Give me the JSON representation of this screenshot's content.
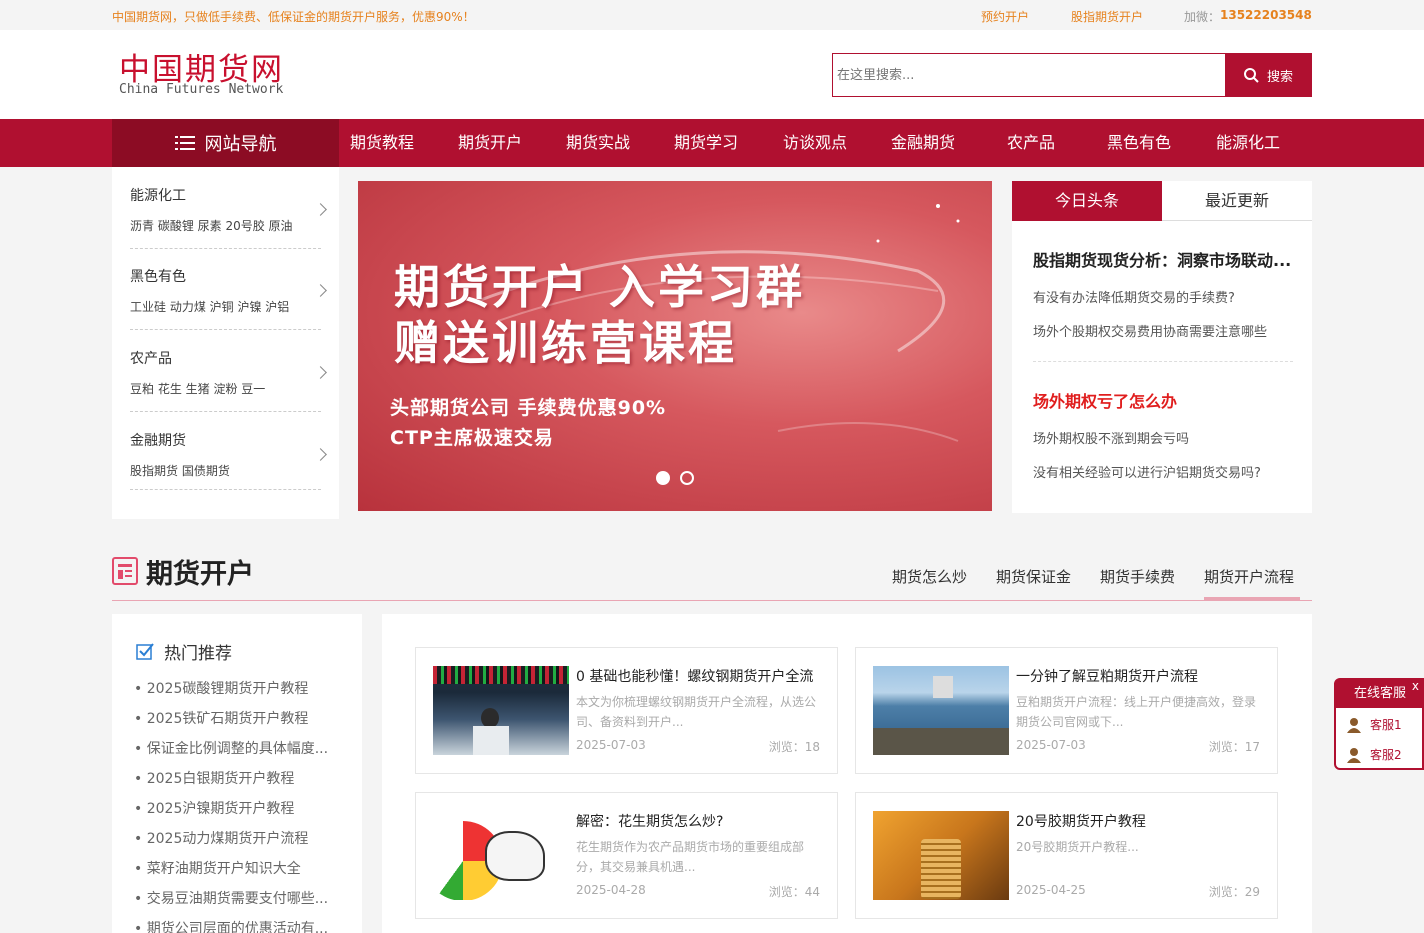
{
  "topbar": {
    "slogan": "中国期货网，只做低手续费、低保证金的期货开户服务，优惠90%！",
    "link1": "预约开户",
    "link2": "股指期货开户",
    "wechat_label": "加微：",
    "wechat": "13522203548"
  },
  "logo": {
    "cn": "中国期货网",
    "en": "China Futures Network"
  },
  "search": {
    "placeholder": "在这里搜索...",
    "button": "搜索"
  },
  "nav": {
    "home": "网站导航",
    "items": [
      "期货教程",
      "期货开户",
      "期货实战",
      "期货学习",
      "访谈观点",
      "金融期货",
      "农产品",
      "黑色有色",
      "能源化工"
    ]
  },
  "categories": [
    {
      "title": "能源化工",
      "subs": "沥青 碳酸锂 尿素 20号胶 原油"
    },
    {
      "title": "黑色有色",
      "subs": "工业硅 动力煤 沪铜 沪镍 沪铝"
    },
    {
      "title": "农产品",
      "subs": "豆粕 花生 生猪 淀粉 豆一"
    },
    {
      "title": "金融期货",
      "subs": "股指期货 国债期货"
    }
  ],
  "banner": {
    "line1": "期货开户 入学习群",
    "line2": "赠送训练营课程",
    "sub1": "头部期货公司 手续费优惠90%",
    "sub2": "CTP主席极速交易"
  },
  "headlines": {
    "tab_active": "今日头条",
    "tab_other": "最近更新",
    "top1": "股指期货现货分析：洞察市场联动...",
    "items1": [
      "有没有办法降低期货交易的手续费?",
      "场外个股期权交易费用协商需要注意哪些"
    ],
    "top2": "场外期权亏了怎么办",
    "items2": [
      "场外期权股不涨到期会亏吗",
      "没有相关经验可以进行沪铝期货交易吗?"
    ]
  },
  "section": {
    "title": "期货开户",
    "tabs": [
      "期货怎么炒",
      "期货保证金",
      "期货手续费",
      "期货开户流程"
    ]
  },
  "hot": {
    "title": "热门推荐",
    "items": [
      "2025碳酸锂期货开户教程",
      "2025铁矿石期货开户教程",
      "保证金比例调整的具体幅度...",
      "2025白银期货开户教程",
      "2025沪镍期货开户教程",
      "2025动力煤期货开户流程",
      "菜籽油期货开户知识大全",
      "交易豆油期货需要支付哪些...",
      "期货公司层面的优惠活动有..."
    ]
  },
  "cards": [
    {
      "title": "0 基础也能秒懂！螺纹钢期货开户全流",
      "desc": "本文为你梳理螺纹钢期货开户全流程，从选公司、备资料到开户...",
      "date": "2025-07-03",
      "views": "浏览：18"
    },
    {
      "title": "一分钟了解豆粕期货开户流程",
      "desc": "豆粕期货开户流程：线上开户便捷高效，登录期货公司官网或下...",
      "date": "2025-07-03",
      "views": "浏览：17"
    },
    {
      "title": "解密：花生期货怎么炒?",
      "desc": "花生期货作为农产品期货市场的重要组成部分，其交易兼具机遇...",
      "date": "2025-04-28",
      "views": "浏览：44"
    },
    {
      "title": "20号胶期货开户教程",
      "desc": "20号胶期货开户教程...",
      "date": "2025-04-25",
      "views": "浏览：29"
    }
  ],
  "kefu": {
    "title": "在线客服",
    "close": "x",
    "items": [
      "客服1",
      "客服2"
    ]
  },
  "colors": {
    "brand": "#b01030",
    "accent": "#e6821e"
  }
}
